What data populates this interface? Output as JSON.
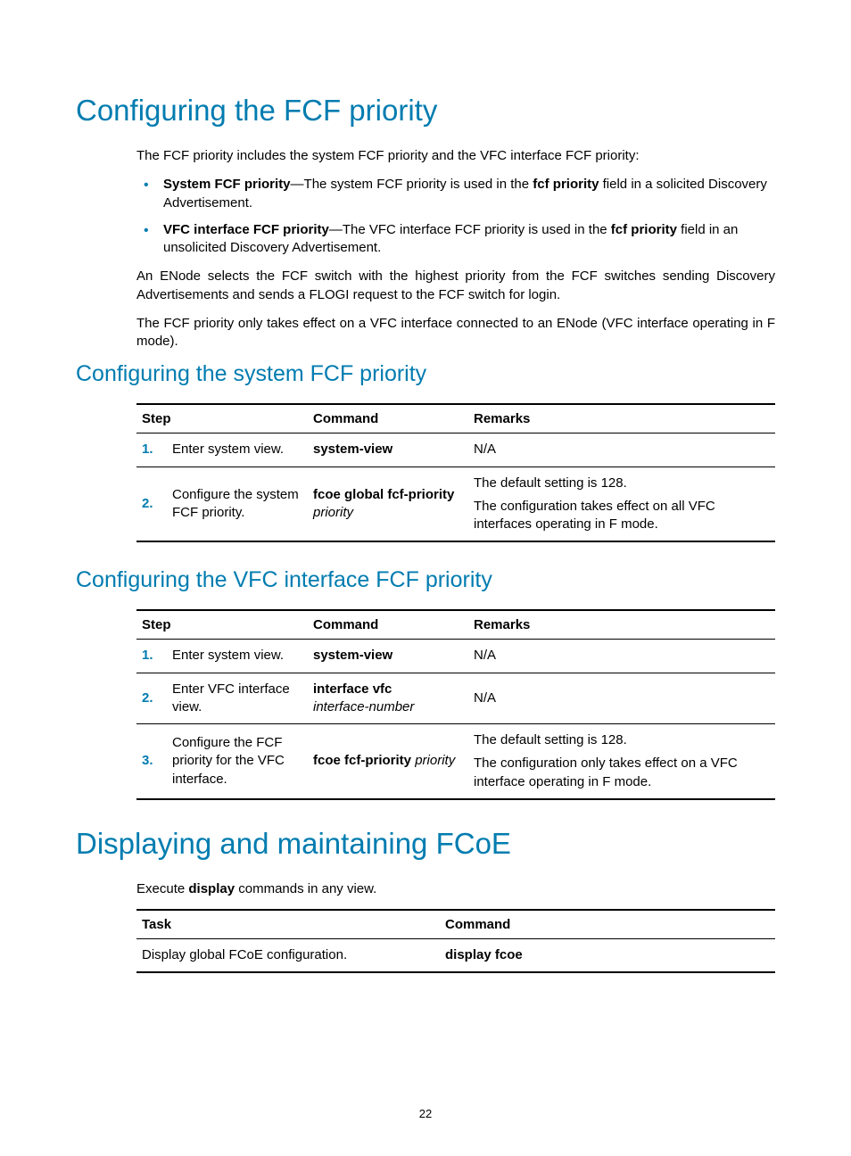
{
  "heading1": "Configuring the FCF priority",
  "intro": "The FCF priority includes the system FCF priority and the VFC interface FCF priority:",
  "bullets": [
    {
      "lead": "System FCF priority",
      "text": "—The system FCF priority is used in the ",
      "bold2": "fcf priority",
      "tail": " field in a solicited Discovery Advertisement."
    },
    {
      "lead": "VFC interface FCF priority",
      "text": "—The VFC interface FCF priority is used in the ",
      "bold2": "fcf priority",
      "tail": " field in an unsolicited Discovery Advertisement."
    }
  ],
  "para2": "An ENode selects the FCF switch with the highest priority from the FCF switches sending Discovery Advertisements and sends a FLOGI request to the FCF switch for login.",
  "para3": "The FCF priority only takes effect on a VFC interface connected to an ENode (VFC interface operating in F mode).",
  "section_sys": {
    "title": "Configuring the system FCF priority",
    "headers": {
      "step": "Step",
      "command": "Command",
      "remarks": "Remarks"
    },
    "rows": [
      {
        "num": "1.",
        "step": "Enter system view.",
        "cmd_bold": "system-view",
        "cmd_ital": "",
        "remarks": [
          "N/A"
        ]
      },
      {
        "num": "2.",
        "step": "Configure the system FCF priority.",
        "cmd_bold": "fcoe global fcf-priority",
        "cmd_ital": "priority",
        "remarks": [
          "The default setting is 128.",
          "The configuration takes effect on all VFC interfaces operating in F mode."
        ]
      }
    ]
  },
  "section_vfc": {
    "title": "Configuring the VFC interface FCF priority",
    "headers": {
      "step": "Step",
      "command": "Command",
      "remarks": "Remarks"
    },
    "rows": [
      {
        "num": "1.",
        "step": "Enter system view.",
        "cmd_bold": "system-view",
        "cmd_ital": "",
        "remarks": [
          "N/A"
        ]
      },
      {
        "num": "2.",
        "step": "Enter VFC interface view.",
        "cmd_bold": "interface vfc",
        "cmd_ital": "interface-number",
        "remarks": [
          "N/A"
        ]
      },
      {
        "num": "3.",
        "step": "Configure the FCF priority for the VFC interface.",
        "cmd_bold": "fcoe fcf-priority",
        "cmd_ital": "priority",
        "cmd_inline": true,
        "remarks": [
          "The default setting is 128.",
          "The configuration only takes effect on a VFC interface operating in F mode."
        ]
      }
    ]
  },
  "heading2": "Displaying and maintaining FCoE",
  "display_intro_pre": "Execute ",
  "display_intro_bold": "display",
  "display_intro_post": " commands in any view.",
  "display_table": {
    "headers": {
      "task": "Task",
      "command": "Command"
    },
    "rows": [
      {
        "task": "Display global FCoE configuration.",
        "cmd_bold": "display fcoe"
      }
    ]
  },
  "pagenum": "22"
}
